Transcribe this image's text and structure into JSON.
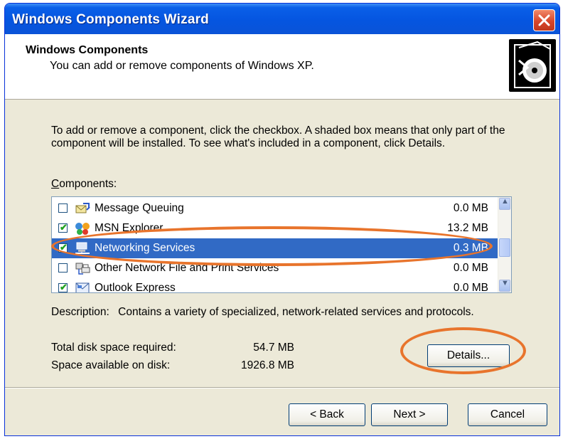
{
  "window": {
    "title": "Windows Components Wizard"
  },
  "header": {
    "title": "Windows Components",
    "subtitle": "You can add or remove components of Windows XP."
  },
  "intro": "To add or remove a component, click the checkbox.  A shaded box means that only part of the component will be installed.  To see what's included in a component, click Details.",
  "components_label": "Components:",
  "components": [
    {
      "name": "Message Queuing",
      "size": "0.0 MB",
      "checked": false,
      "selected": false,
      "icon": "message-queuing-icon"
    },
    {
      "name": "MSN Explorer",
      "size": "13.2 MB",
      "checked": true,
      "selected": false,
      "icon": "msn-butterfly-icon"
    },
    {
      "name": "Networking Services",
      "size": "0.3 MB",
      "checked": true,
      "selected": true,
      "icon": "network-services-icon"
    },
    {
      "name": "Other Network File and Print Services",
      "size": "0.0 MB",
      "checked": false,
      "selected": false,
      "icon": "print-services-icon"
    },
    {
      "name": "Outlook Express",
      "size": "0.0 MB",
      "checked": true,
      "selected": false,
      "icon": "outlook-express-icon"
    }
  ],
  "description": {
    "label": "Description:",
    "text": "Contains a variety of specialized, network-related services and protocols."
  },
  "disk": {
    "required_label": "Total disk space required:",
    "required_value": "54.7 MB",
    "available_label": "Space available on disk:",
    "available_value": "1926.8 MB"
  },
  "buttons": {
    "details": "Details...",
    "back": "< Back",
    "next": "Next >",
    "cancel": "Cancel"
  },
  "colors": {
    "selection": "#316ac5",
    "annotation": "#e8742c",
    "titlebar": "#0555e0"
  }
}
